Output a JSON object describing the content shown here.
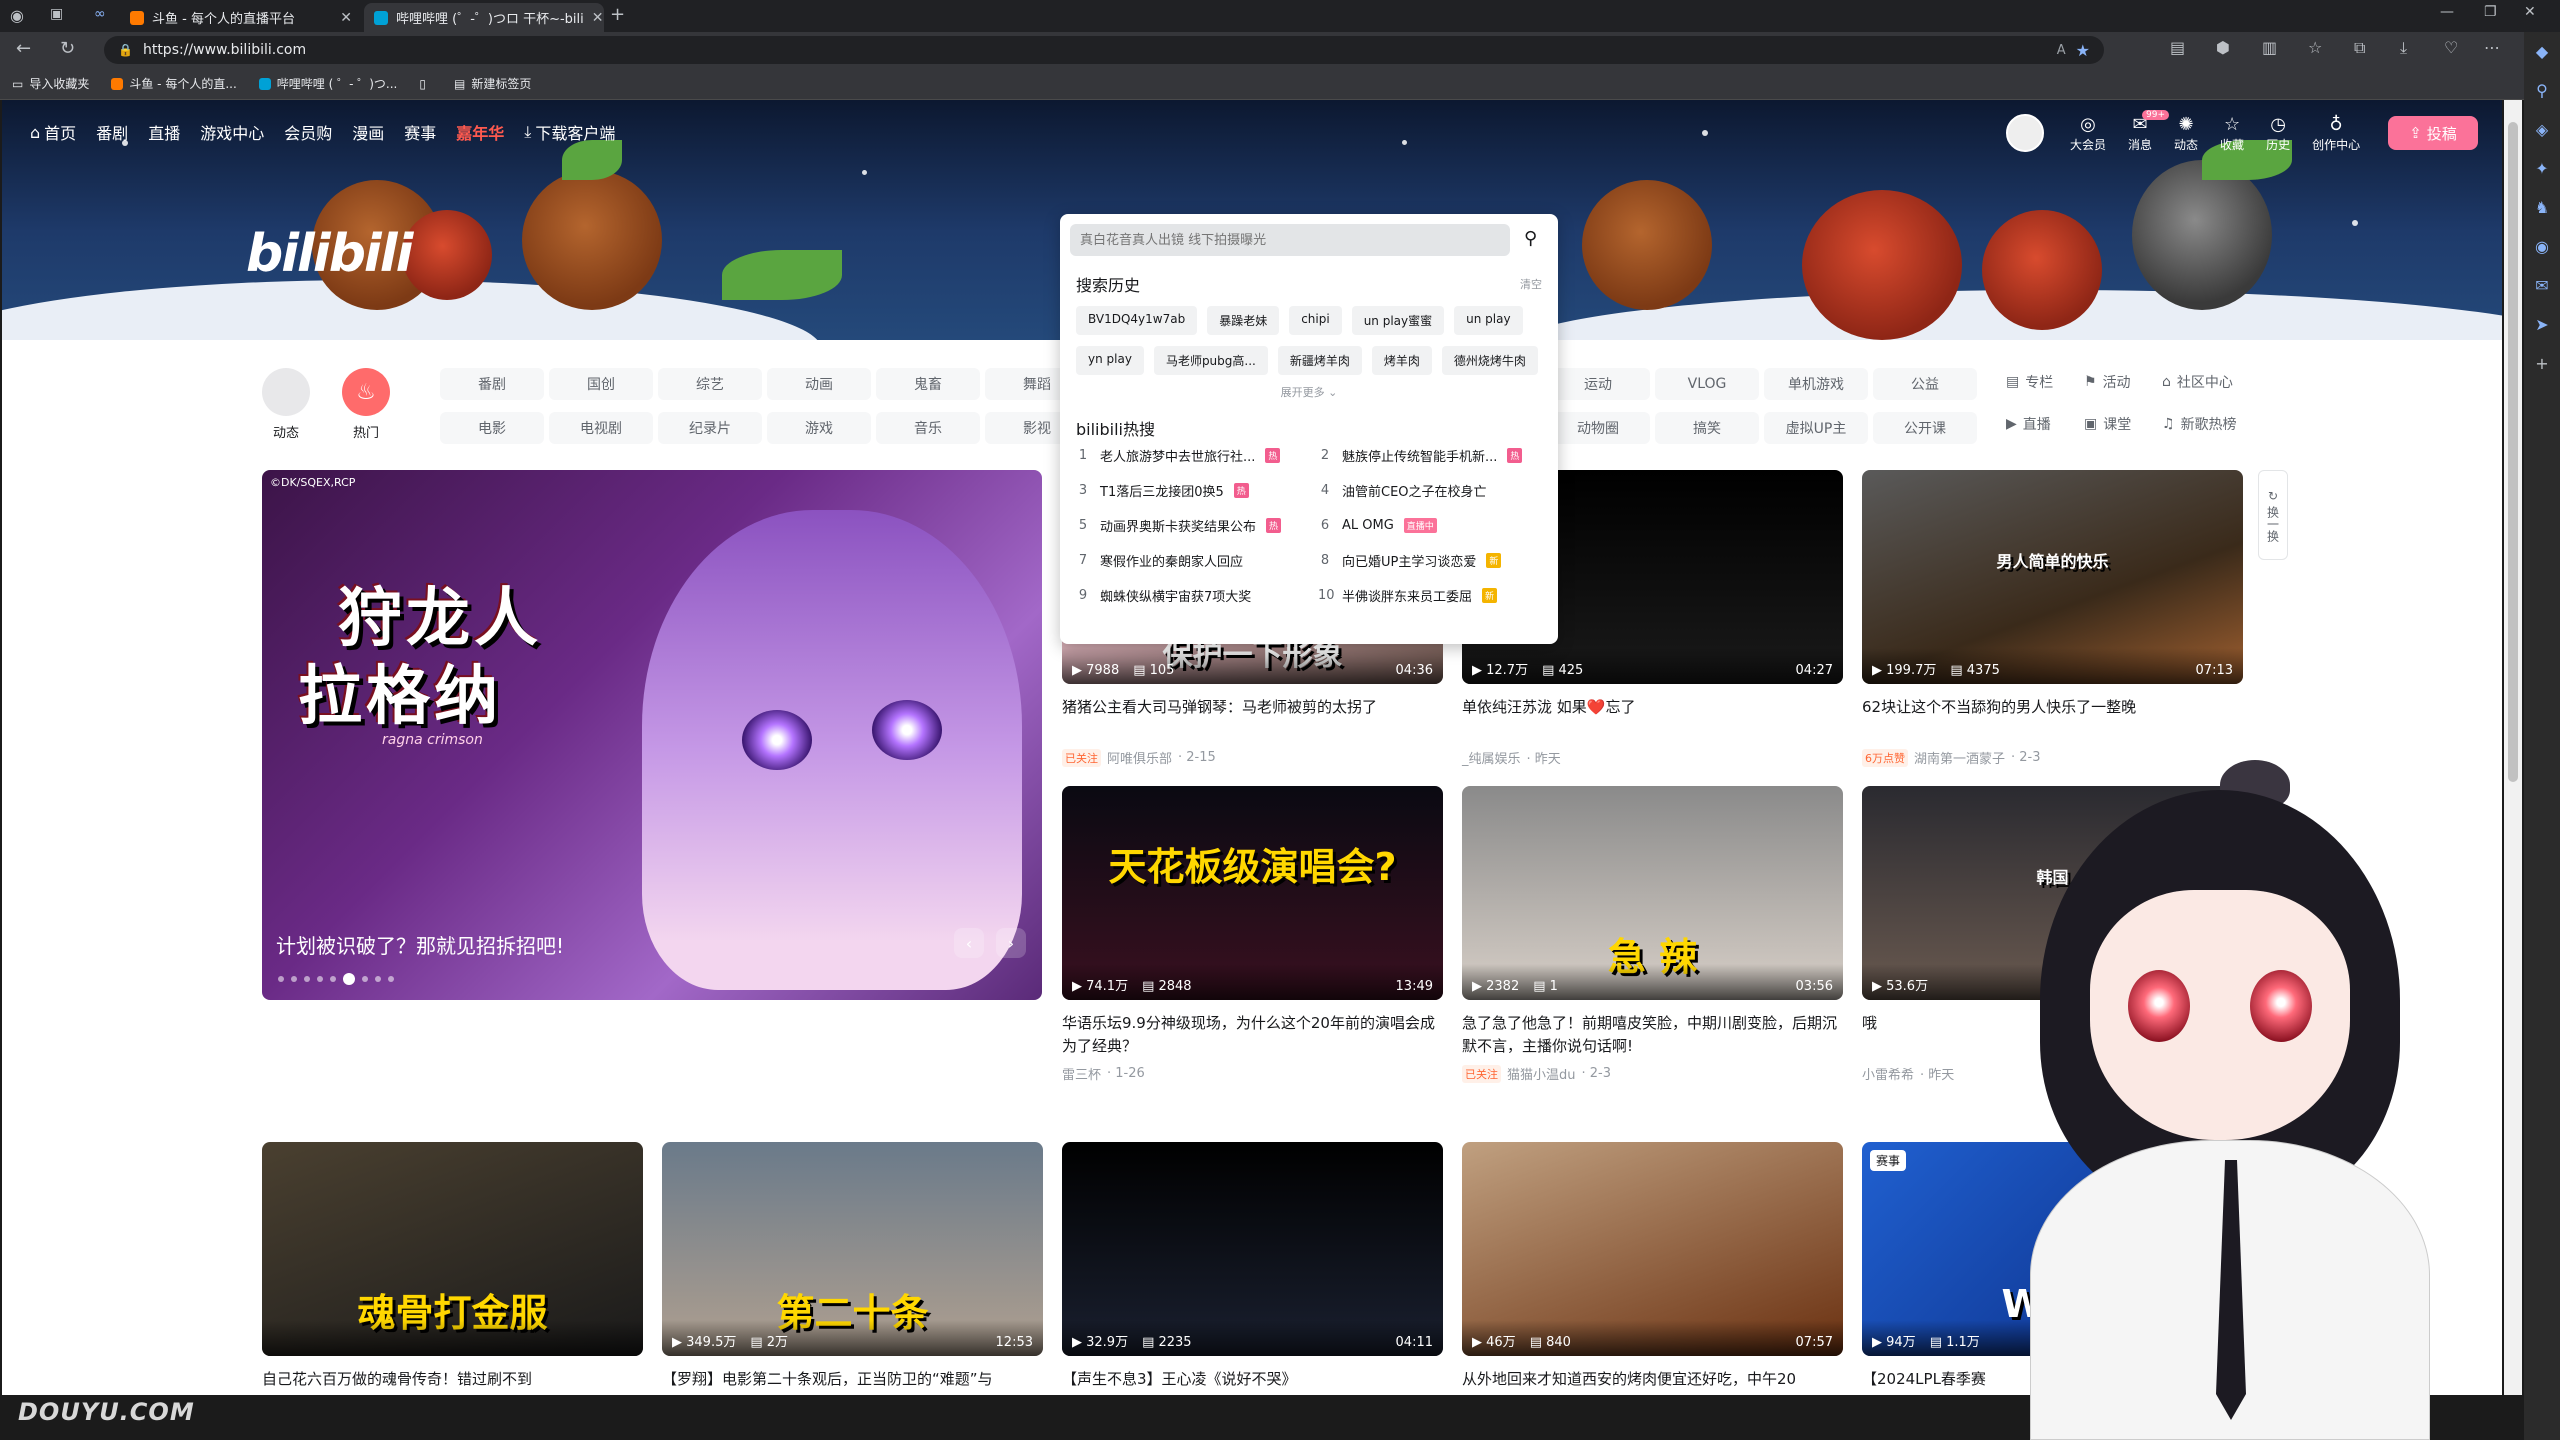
{
  "browser": {
    "tabs": [
      {
        "label": "斗鱼 - 每个人的直播平台",
        "color": "#ff7a00"
      },
      {
        "label": "哔哩哔哩 (゜-゜)つロ 干杯~-bili",
        "color": "#00a1d6"
      }
    ],
    "new_tab_icon": "plus-icon",
    "url": "https://www.bilibili.com",
    "read_aloud": "A",
    "favorites": [
      {
        "label": "导入收藏夹"
      },
      {
        "label": "斗鱼 - 每个人的直..."
      },
      {
        "label": "哔哩哔哩 ( ゜- ゜)つ..."
      },
      {
        "label": ""
      },
      {
        "label": "新建标签页"
      }
    ]
  },
  "top_nav": {
    "items": [
      "首页",
      "番剧",
      "直播",
      "游戏中心",
      "会员购",
      "漫画",
      "赛事"
    ],
    "highlight": "嘉年华",
    "download": "下载客户端"
  },
  "right_nav": {
    "items": [
      {
        "label": "大会员",
        "icon": "vip-icon"
      },
      {
        "label": "消息",
        "icon": "message-icon",
        "badge": "99+"
      },
      {
        "label": "动态",
        "icon": "dynamic-icon"
      },
      {
        "label": "收藏",
        "icon": "star-icon"
      },
      {
        "label": "历史",
        "icon": "clock-icon"
      },
      {
        "label": "创作中心",
        "icon": "bulb-icon"
      }
    ],
    "upload": "投稿"
  },
  "banner": {
    "logo": "bilibili"
  },
  "search": {
    "placeholder": "真白花音真人出镜 线下拍摄曝光",
    "history_title": "搜索历史",
    "clear": "清空",
    "history": [
      "BV1DQ4y1w7ab",
      "暴躁老妹",
      "chipi",
      "un play蜜蜜",
      "un play",
      "yn play",
      "马老师pubg高...",
      "新疆烤羊肉",
      "烤羊肉",
      "德州烧烤牛肉"
    ],
    "expand": "展开更多",
    "hot_title": "bilibili热搜",
    "hot": [
      {
        "rank": "1",
        "text": "老人旅游梦中去世旅行社...",
        "tag": "热",
        "tag_color": "#f25d8e"
      },
      {
        "rank": "2",
        "text": "魅族停止传统智能手机新...",
        "tag": "热",
        "tag_color": "#f25d8e"
      },
      {
        "rank": "3",
        "text": "T1落后三龙接团0换5",
        "tag": "热",
        "tag_color": "#f25d8e"
      },
      {
        "rank": "4",
        "text": "油管前CEO之子在校身亡",
        "tag": "",
        "tag_color": ""
      },
      {
        "rank": "5",
        "text": "动画界奥斯卡获奖结果公布",
        "tag": "热",
        "tag_color": "#f25d8e"
      },
      {
        "rank": "6",
        "text": "AL OMG",
        "tag": "直播中",
        "tag_color": "#fb7299"
      },
      {
        "rank": "7",
        "text": "寒假作业的秦朗家人回应",
        "tag": "",
        "tag_color": ""
      },
      {
        "rank": "8",
        "text": "向已婚UP主学习谈恋爱",
        "tag": "新",
        "tag_color": "#f4b400"
      },
      {
        "rank": "9",
        "text": "蜘蛛侠纵横宇宙获7项大奖",
        "tag": "",
        "tag_color": ""
      },
      {
        "rank": "10",
        "text": "半佛谈胖东来员工委屈",
        "tag": "新",
        "tag_color": "#f4b400"
      }
    ]
  },
  "channels": {
    "dynamic": "动态",
    "hot": "热门",
    "grid1": [
      "番剧",
      "国创",
      "综艺",
      "动画",
      "鬼畜",
      "舞蹈",
      "电影",
      "电视剧",
      "纪录片",
      "游戏",
      "音乐",
      "影视"
    ],
    "grid2": [
      "运动",
      "VLOG",
      "单机游戏",
      "公益",
      "动物圈",
      "搞笑",
      "虚拟UP主",
      "公开课"
    ],
    "links": [
      {
        "label": "专栏",
        "icon": "column-icon"
      },
      {
        "label": "活动",
        "icon": "flag-icon"
      },
      {
        "label": "社区中心",
        "icon": "community-icon"
      },
      {
        "label": "直播",
        "icon": "live-icon"
      },
      {
        "label": "课堂",
        "icon": "class-icon"
      },
      {
        "label": "新歌热榜",
        "icon": "music-icon"
      }
    ]
  },
  "carousel": {
    "copyright": "©DK/SQEX,RCP",
    "hero_line1": "狩龙人",
    "hero_line2": "拉格纳",
    "hero_sub": "ragna crimson",
    "caption": "计划被识破了？那就见招拆招吧!",
    "dots": 9,
    "active_dot": 5
  },
  "refresh": {
    "label": "换一换"
  },
  "videos": [
    {
      "title": "猪猪公主看大司马弹钢琴：马老师被剪的太拐了",
      "views": "7988",
      "danmaku": "105",
      "duration": "04:36",
      "tag": "已关注",
      "author": "阿唯俱乐部",
      "date": "2-15",
      "overlay": "保护一下形象"
    },
    {
      "title": "单依纯汪苏泷 如果❤️忘了",
      "views": "12.7万",
      "danmaku": "425",
      "duration": "04:27",
      "tag": "",
      "author": "_纯属娱乐",
      "date": "昨天",
      "overlay": ""
    },
    {
      "title": "62块让这个不当舔狗的男人快乐了一整晚",
      "views": "199.7万",
      "danmaku": "4375",
      "duration": "07:13",
      "tag": "6万点赞",
      "author": "湖南第一酒蒙子",
      "date": "2-3",
      "overlay": "男人简单的快乐"
    },
    {
      "title": "华语乐坛9.9分神级现场，为什么这个20年前的演唱会成为了经典？",
      "views": "74.1万",
      "danmaku": "2848",
      "duration": "13:49",
      "tag": "",
      "author": "雷三杯",
      "date": "1-26",
      "overlay": "天花板级演唱会?"
    },
    {
      "title": "急了急了他急了！前期嘻皮笑脸，中期川剧变脸，后期沉默不言，主播你说句话啊!",
      "views": "2382",
      "danmaku": "1",
      "duration": "03:56",
      "tag": "已关注",
      "author": "猫猫小温du",
      "date": "2-3",
      "overlay": "急    辣"
    },
    {
      "title": "哦",
      "views": "53.6万",
      "danmaku": "",
      "duration": "",
      "tag": "",
      "author": "小雷希希",
      "date": "昨天",
      "overlay": "韩国"
    },
    {
      "title": "自己花六百万做的魂骨传奇！错过刷不到",
      "views": "",
      "danmaku": "",
      "duration": "",
      "tag": "",
      "author": "",
      "date": "",
      "overlay": "魂骨打金服"
    },
    {
      "title": "【罗翔】电影第二十条观后，正当防卫的“难题”与",
      "views": "349.5万",
      "danmaku": "2万",
      "duration": "12:53",
      "tag": "",
      "author": "",
      "date": "",
      "overlay": "第二十条"
    },
    {
      "title": "【声生不息3】王心凌《说好不哭》",
      "views": "32.9万",
      "danmaku": "2235",
      "duration": "04:11",
      "tag": "",
      "author": "",
      "date": "",
      "overlay": ""
    },
    {
      "title": "从外地回来才知道西安的烤肉便宜还好吃，中午20",
      "views": "46万",
      "danmaku": "840",
      "duration": "07:57",
      "tag": "",
      "author": "",
      "date": "",
      "overlay": ""
    },
    {
      "title": "【2024LPL春季赛",
      "views": "94万",
      "danmaku": "1.1万",
      "duration": "",
      "tag": "赛事",
      "author": "",
      "date": "",
      "overlay": "WBG"
    }
  ],
  "watermark": "DOUYU.COM",
  "colors": {
    "accent": "#fb7299",
    "hot_red": "#ff5a4f",
    "bg_dark": "#202124"
  }
}
